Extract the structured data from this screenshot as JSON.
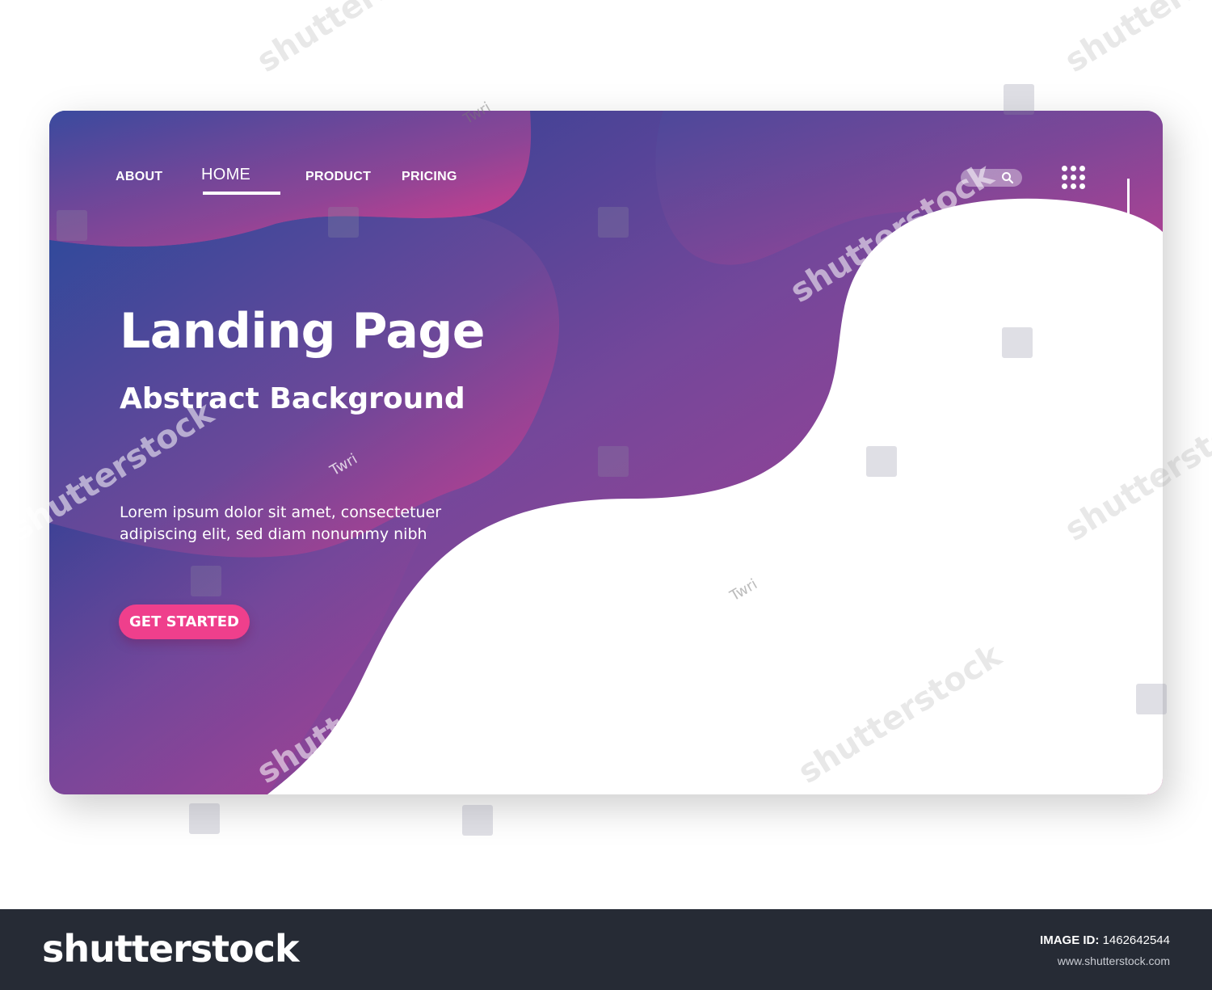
{
  "nav": {
    "items": [
      "ABOUT",
      "HOME",
      "PRODUCT",
      "PRICING"
    ],
    "active": "HOME"
  },
  "hero": {
    "title": "Landing Page",
    "subtitle": "Abstract Background",
    "body_line1": "Lorem ipsum dolor sit amet, consectetuer",
    "body_line2": "adipiscing elit, sed diam nonummy nibh",
    "cta_label": "GET STARTED"
  },
  "icons": {
    "search": "search-icon",
    "menu": "grid-menu-icon"
  },
  "watermark": {
    "brand": "shutterstock",
    "contributor": "Twri"
  },
  "footer": {
    "logo": "shutterstock",
    "image_id_label": "IMAGE ID:",
    "image_id": "1462642544",
    "url": "www.shutterstock.com"
  },
  "colors": {
    "gradient_blue": "#1f3f94",
    "gradient_purple": "#7b4897",
    "gradient_pink": "#d23b8e",
    "cta": "#ef3f8c",
    "footer_bg": "#262b35"
  }
}
